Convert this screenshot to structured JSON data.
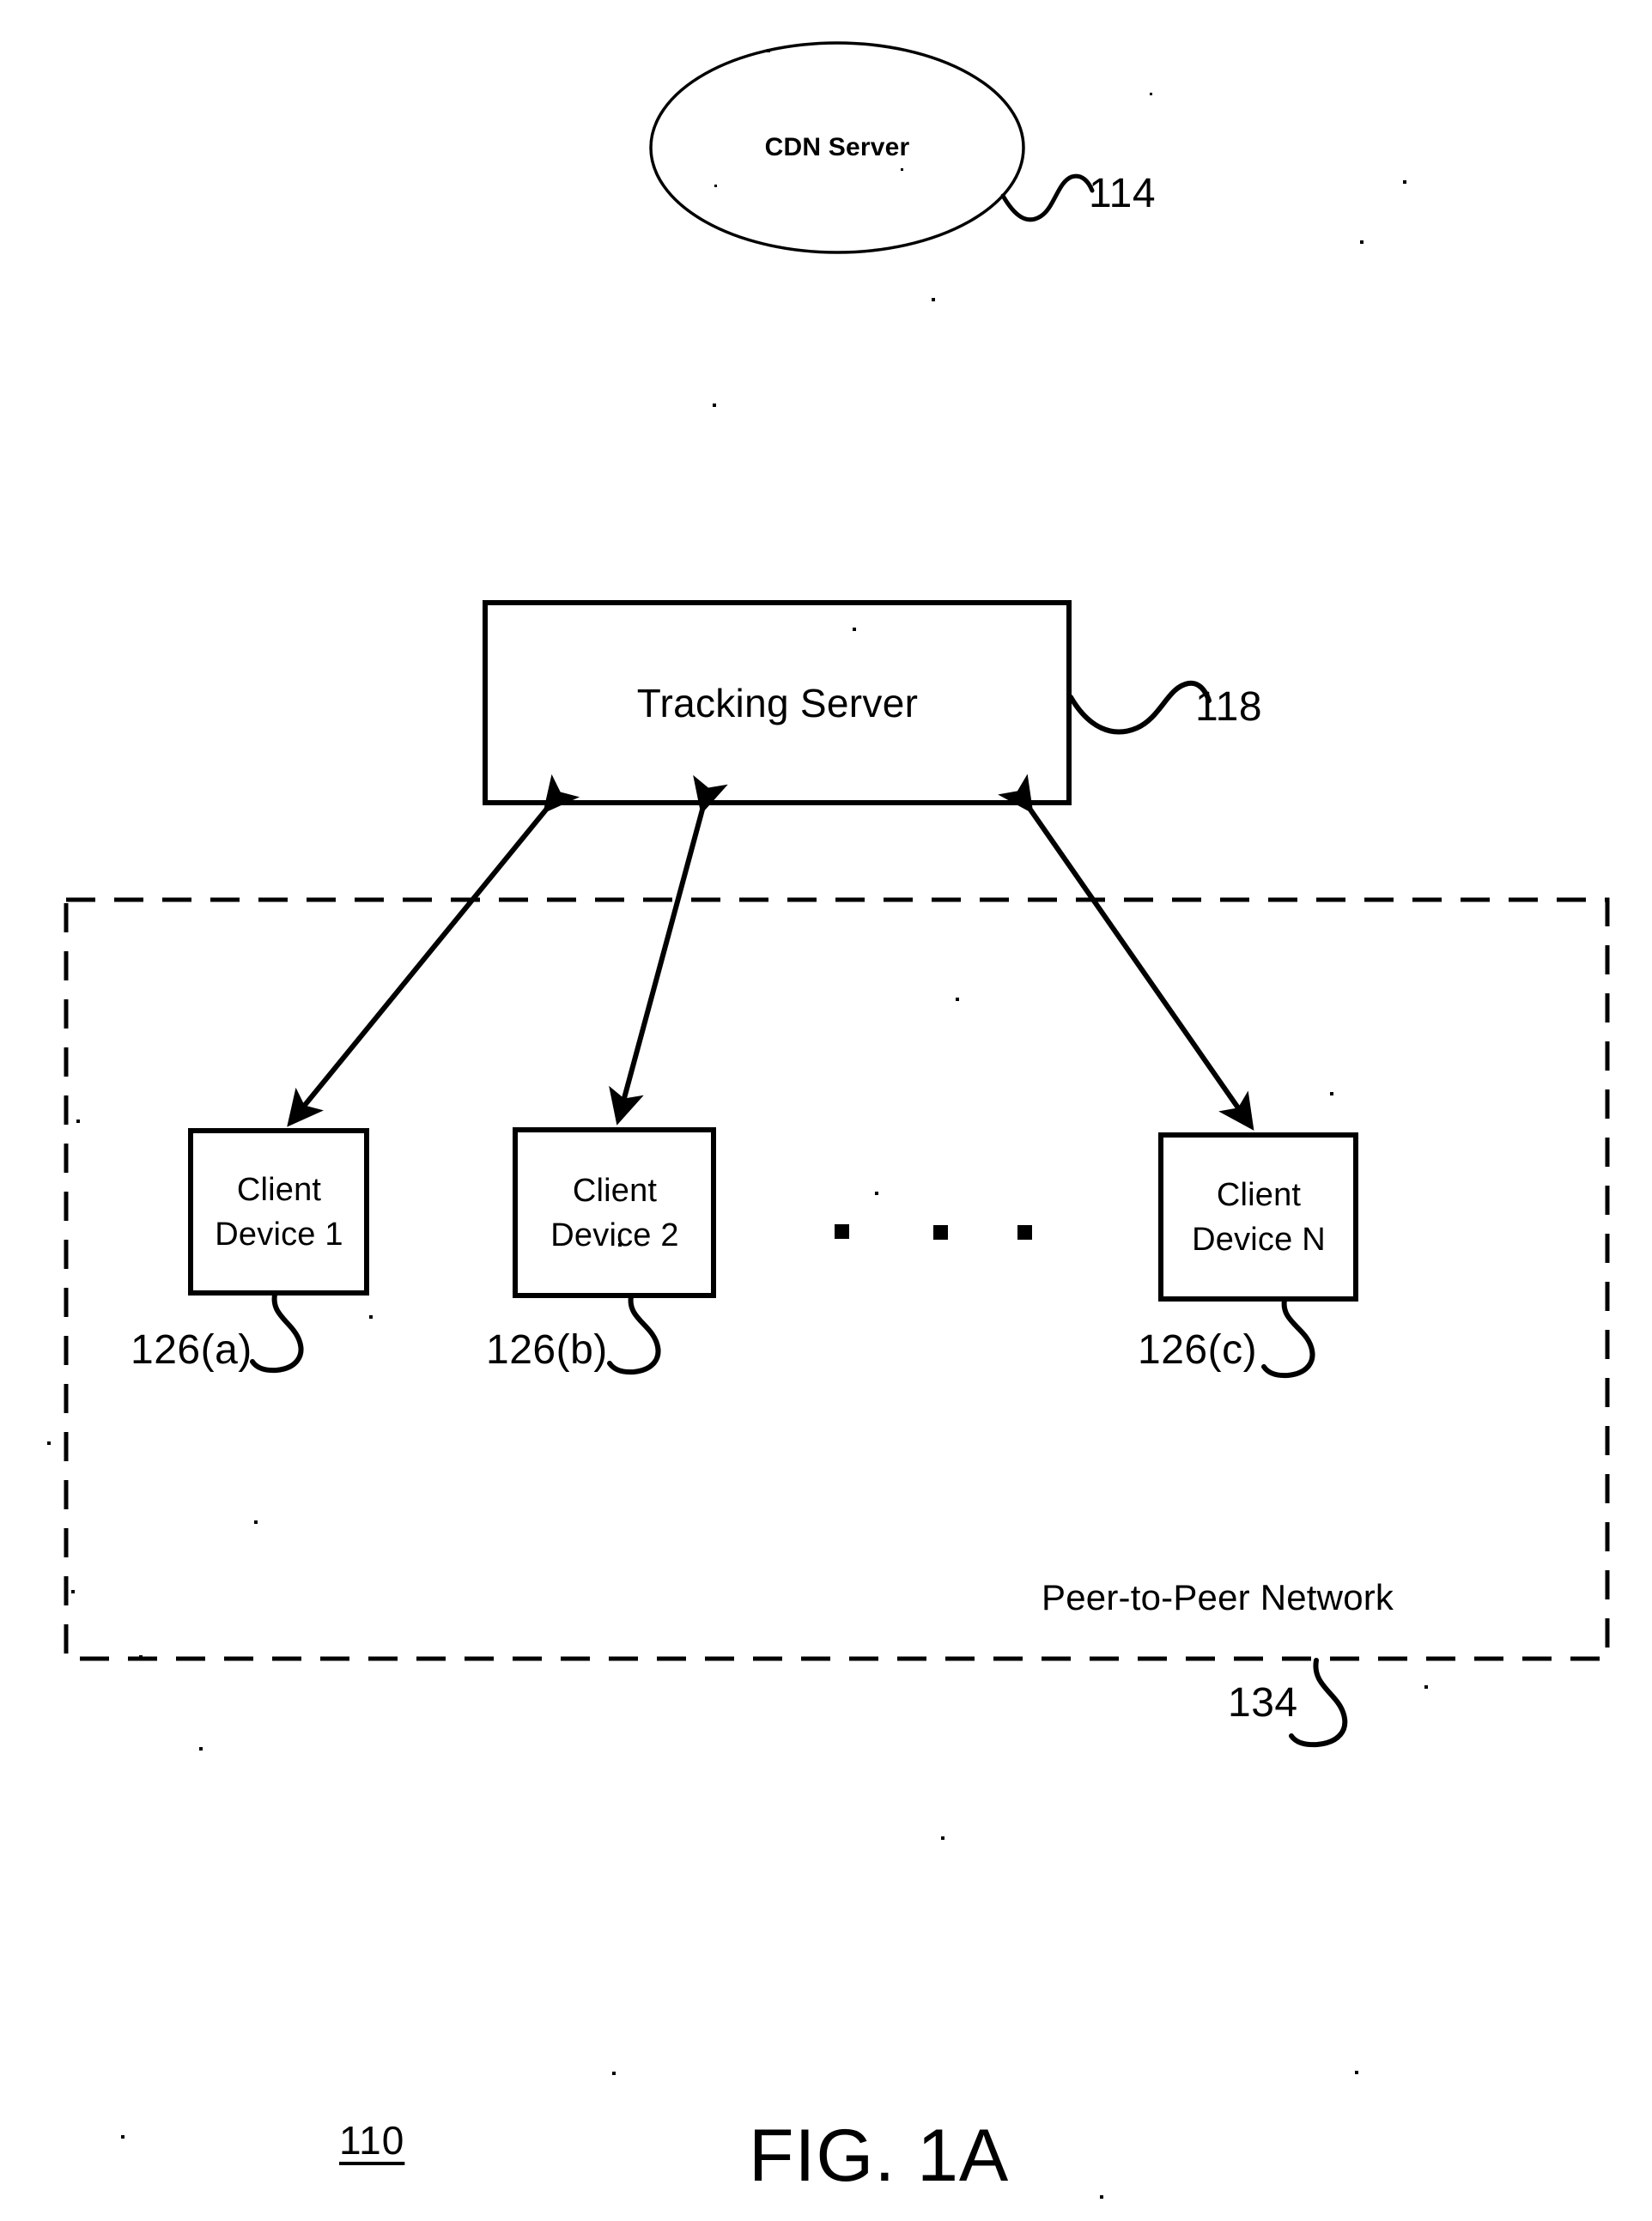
{
  "figure": {
    "title": "FIG. 1A",
    "number": "110"
  },
  "nodes": {
    "cdn_server": {
      "label": "CDN Server",
      "ref": "114",
      "shape": "ellipse"
    },
    "tracking_server": {
      "label": "Tracking Server",
      "ref": "118",
      "shape": "rectangle"
    },
    "client_device_1": {
      "line1": "Client",
      "line2": "Device 1",
      "ref": "126(a)",
      "shape": "rectangle"
    },
    "client_device_2": {
      "line1": "Client",
      "line2": "Device 2",
      "ref": "126(b)",
      "shape": "rectangle"
    },
    "client_device_n": {
      "line1": "Client",
      "line2": "Device N",
      "ref": "126(c)",
      "shape": "rectangle"
    }
  },
  "groups": {
    "peer_to_peer_network": {
      "label": "Peer-to-Peer Network",
      "ref": "134",
      "border": "dashed"
    }
  },
  "ellipsis": {
    "symbol": "square-dots",
    "count": 3
  },
  "connections": [
    {
      "name": "tracking-to-device-1",
      "from": "tracking_server",
      "to": "client_device_1",
      "style": "double-headed-arrow"
    },
    {
      "name": "tracking-to-device-2",
      "from": "tracking_server",
      "to": "client_device_2",
      "style": "double-headed-arrow"
    },
    {
      "name": "tracking-to-device-n",
      "from": "tracking_server",
      "to": "client_device_n",
      "style": "double-headed-arrow"
    }
  ],
  "colors": {
    "stroke": "#000000",
    "background": "#ffffff",
    "text": "#000000"
  }
}
